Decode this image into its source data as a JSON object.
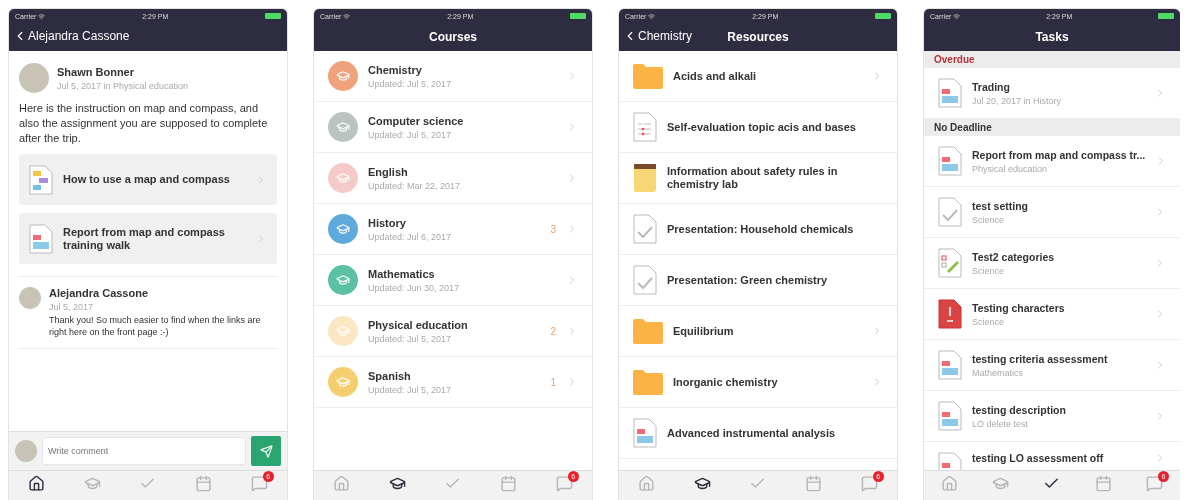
{
  "screens": [
    {
      "kind": "post",
      "status_bar": {
        "carrier": "Carrier",
        "time": "2:29 PM"
      },
      "nav": {
        "back": "Alejandra Cassone"
      },
      "post": {
        "author": "Shawn Bonner",
        "meta": "Jul 5, 2017 in Physical education",
        "body": "Here is the instruction on map and compass, and also the assignment you are supposed to complete after the trip.",
        "attachments": [
          {
            "title": "How to use a map and compass",
            "kind": "presentation"
          },
          {
            "title": "Report from map and compass training walk",
            "kind": "assignment"
          }
        ]
      },
      "comments": [
        {
          "author": "Alejandra Cassone",
          "date": "Jul 5, 2017",
          "text": "Thank you! So much easier to find when the links are right here on the front page :-)"
        }
      ],
      "composer": {
        "placeholder": "Write comment"
      },
      "tabs": [
        {
          "kind": "home",
          "selected": true
        },
        {
          "kind": "courses",
          "selected": false
        },
        {
          "kind": "tasks",
          "selected": false
        },
        {
          "kind": "calendar",
          "selected": false
        },
        {
          "kind": "messages",
          "selected": false,
          "badge": "6"
        }
      ]
    },
    {
      "kind": "courses",
      "status_bar": {
        "carrier": "Carrier",
        "time": "2:29 PM"
      },
      "nav": {
        "title": "Courses"
      },
      "courses": [
        {
          "name": "Chemistry",
          "updated": "Updated: Jul 5, 2017",
          "color": "#f0a27a"
        },
        {
          "name": "Computer science",
          "updated": "Updated: Jul 5, 2017",
          "color": "#b9c3c0"
        },
        {
          "name": "English",
          "updated": "Updated: Mar 22, 2017",
          "color": "#f7caca"
        },
        {
          "name": "History",
          "updated": "Updated: Jul 6, 2017",
          "color": "#5eaadd",
          "count": "3"
        },
        {
          "name": "Mathematics",
          "updated": "Updated: Jun 30, 2017",
          "color": "#5cc0a5"
        },
        {
          "name": "Physical education",
          "updated": "Updated: Jul 5, 2017",
          "color": "#fbe8c3",
          "count": "2"
        },
        {
          "name": "Spanish",
          "updated": "Updated: Jul 5, 2017",
          "color": "#f5cf6f",
          "count": "1"
        }
      ],
      "tabs": [
        {
          "kind": "home",
          "selected": false
        },
        {
          "kind": "courses",
          "selected": true
        },
        {
          "kind": "tasks",
          "selected": false
        },
        {
          "kind": "calendar",
          "selected": false
        },
        {
          "kind": "messages",
          "selected": false,
          "badge": "6"
        }
      ]
    },
    {
      "kind": "resources",
      "status_bar": {
        "carrier": "Carrier",
        "time": "2:29 PM"
      },
      "nav": {
        "back": "Chemistry",
        "title": "Resources"
      },
      "resources": [
        {
          "title": "Acids and alkali",
          "kind": "folder"
        },
        {
          "title": "Self-evaluation topic acis and bases",
          "kind": "checklist"
        },
        {
          "title": "Information about safety rules in chemistry lab",
          "kind": "notebook"
        },
        {
          "title": "Presentation: Household chemicals",
          "kind": "test"
        },
        {
          "title": "Presentation: Green chemistry",
          "kind": "test"
        },
        {
          "title": "Equilibrium",
          "kind": "folder"
        },
        {
          "title": "Inorganic chemistry",
          "kind": "folder"
        },
        {
          "title": "Advanced instrumental analysis",
          "kind": "assignment"
        }
      ],
      "tabs": [
        {
          "kind": "home",
          "selected": false
        },
        {
          "kind": "courses",
          "selected": true
        },
        {
          "kind": "tasks",
          "selected": false
        },
        {
          "kind": "calendar",
          "selected": false
        },
        {
          "kind": "messages",
          "selected": false,
          "badge": "6"
        }
      ]
    },
    {
      "kind": "tasks",
      "status_bar": {
        "carrier": "Carrier",
        "time": "2:29 PM"
      },
      "nav": {
        "title": "Tasks"
      },
      "sections": [
        {
          "title": "Overdue",
          "overdue": true,
          "items": [
            {
              "title": "Trading",
              "subtitle": "Jul 20, 2017 in History",
              "kind": "assignment"
            }
          ]
        },
        {
          "title": "No Deadline",
          "overdue": false,
          "items": [
            {
              "title": "Report from map and compass tr...",
              "subtitle": "Physical education",
              "kind": "assignment"
            },
            {
              "title": "test setting",
              "subtitle": "Science",
              "kind": "test"
            },
            {
              "title": "Test2 categories",
              "subtitle": "Science",
              "kind": "categories"
            },
            {
              "title": "Testing characters",
              "subtitle": "Science",
              "kind": "characters"
            },
            {
              "title": "testing criteria assessment",
              "subtitle": "Mathematics",
              "kind": "assignment"
            },
            {
              "title": "testing description",
              "subtitle": "LO delete test",
              "kind": "assignment"
            },
            {
              "title": "testing LO assessment off",
              "kind": "assignment"
            }
          ]
        }
      ],
      "tabs": [
        {
          "kind": "home",
          "selected": false
        },
        {
          "kind": "courses",
          "selected": false
        },
        {
          "kind": "tasks",
          "selected": true
        },
        {
          "kind": "calendar",
          "selected": false
        },
        {
          "kind": "messages",
          "selected": false,
          "badge": "6"
        }
      ]
    }
  ]
}
